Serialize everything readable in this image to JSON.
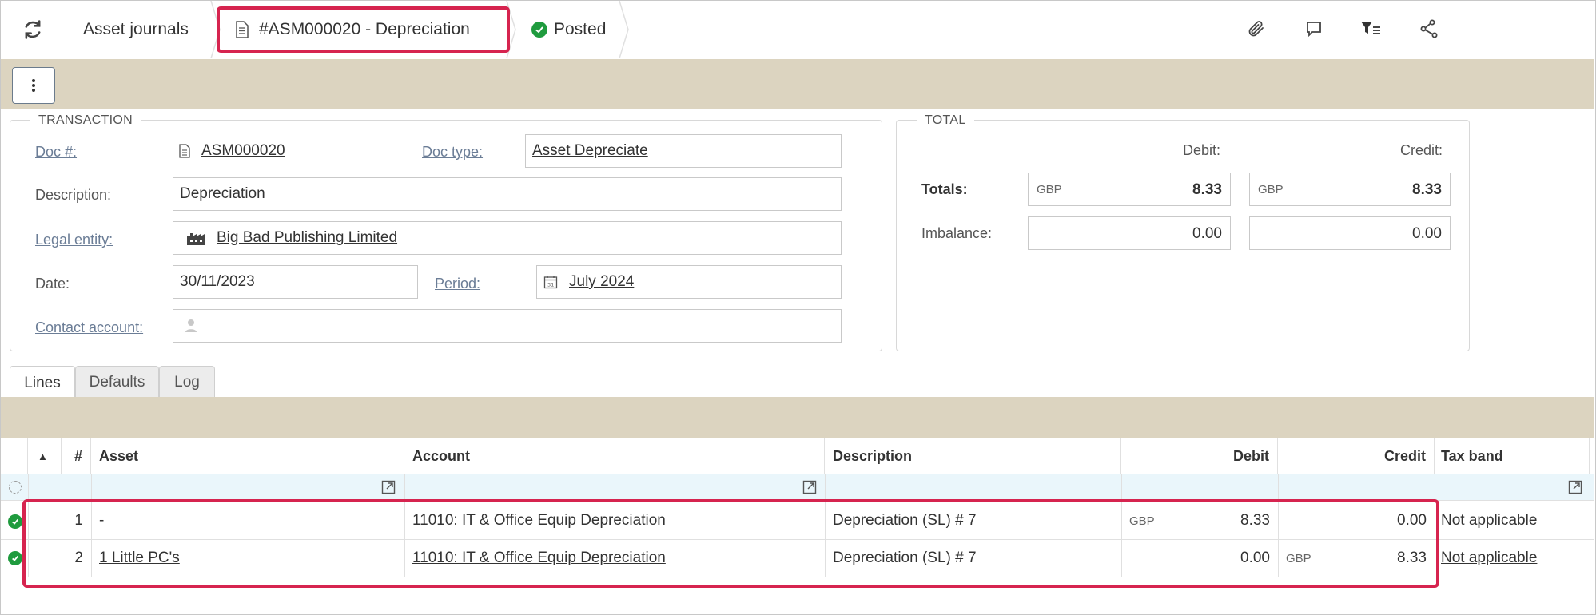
{
  "breadcrumb": {
    "items": [
      "Asset journals",
      "#ASM000020 - Depreciation",
      "Posted"
    ]
  },
  "toolbar_icons": [
    "paperclip-icon",
    "comment-icon",
    "filter-list-icon",
    "share-icon"
  ],
  "transaction": {
    "title": "TRANSACTION",
    "doc_no_label": "Doc #:",
    "doc_no_value": "ASM000020",
    "doc_type_label": "Doc type:",
    "doc_type_value": "Asset Depreciate",
    "description_label": "Description:",
    "description_value": "Depreciation",
    "legal_entity_label": "Legal entity:",
    "legal_entity_value": "Big Bad Publishing Limited",
    "date_label": "Date:",
    "date_value": "30/11/2023",
    "period_label": "Period:",
    "period_value": "July 2024",
    "contact_label": "Contact account:",
    "contact_value": ""
  },
  "total": {
    "title": "TOTAL",
    "debit_label": "Debit:",
    "credit_label": "Credit:",
    "totals_label": "Totals:",
    "imbalance_label": "Imbalance:",
    "totals_debit_cur": "GBP",
    "totals_debit": "8.33",
    "totals_credit_cur": "GBP",
    "totals_credit": "8.33",
    "imbalance_debit": "0.00",
    "imbalance_credit": "0.00"
  },
  "tabs": [
    "Lines",
    "Defaults",
    "Log"
  ],
  "grid": {
    "headers": {
      "sort": "▲",
      "num": "#",
      "asset": "Asset",
      "account": "Account",
      "description": "Description",
      "debit": "Debit",
      "credit": "Credit",
      "tax_band": "Tax band"
    },
    "rows": [
      {
        "num": "1",
        "asset": "-",
        "account": "11010: IT & Office Equip Depreciation",
        "description": "Depreciation (SL) # 7",
        "debit_cur": "GBP",
        "debit": "8.33",
        "credit_cur": "",
        "credit": "0.00",
        "tax_band": "Not applicable"
      },
      {
        "num": "2",
        "asset": "1 Little PC's",
        "account": "11010: IT & Office Equip Depreciation",
        "description": "Depreciation (SL) # 7",
        "debit_cur": "",
        "debit": "0.00",
        "credit_cur": "GBP",
        "credit": "8.33",
        "tax_band": "Not applicable"
      }
    ]
  },
  "colors": {
    "highlight": "#d6244f",
    "band": "#dcd4c0",
    "posted_green": "#1f9b3e",
    "filter_row": "#eaf6fb"
  }
}
